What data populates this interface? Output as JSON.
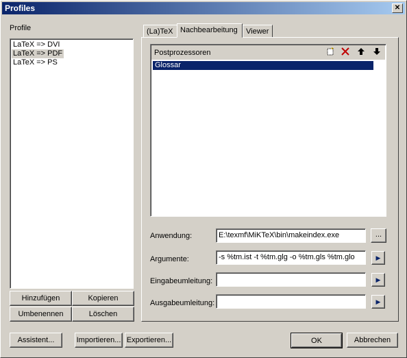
{
  "window": {
    "title": "Profiles",
    "close_glyph": "✕"
  },
  "profile": {
    "label": "Profile",
    "items": [
      "LaTeX => DVI",
      "LaTeX => PDF",
      "LaTeX => PS"
    ],
    "selected_index": 1
  },
  "profile_buttons": {
    "add": "Hinzufügen",
    "copy": "Kopieren",
    "rename": "Umbenennen",
    "delete": "Löschen"
  },
  "tabs": [
    "(La)TeX",
    "Nachbearbeitung",
    "Viewer"
  ],
  "active_tab": 1,
  "postprocessors": {
    "header": "Postprozessoren",
    "items": [
      "Glossar"
    ],
    "selected_index": 0,
    "toolbar_icons": [
      "new-icon",
      "delete-icon",
      "move-up-icon",
      "move-down-icon"
    ]
  },
  "fields": {
    "anwendung": {
      "label": "Anwendung:",
      "value": "E:\\texmf\\MiKTeX\\bin\\makeindex.exe",
      "button": "..."
    },
    "argumente": {
      "label": "Argumente:",
      "value": "-s %tm.ist -t %tm.glg -o %tm.gls %tm.glo"
    },
    "eingabe": {
      "label": "Eingabeumleitung:",
      "value": ""
    },
    "ausgabe": {
      "label": "Ausgabeumleitung:",
      "value": ""
    }
  },
  "bottom_buttons": {
    "assistant": "Assistent...",
    "import": "Importieren...",
    "export": "Exportieren...",
    "ok": "OK",
    "cancel": "Abbrechen"
  },
  "colors": {
    "selection": "#0a246a",
    "title_start": "#0a246a",
    "title_end": "#a6caf0"
  }
}
